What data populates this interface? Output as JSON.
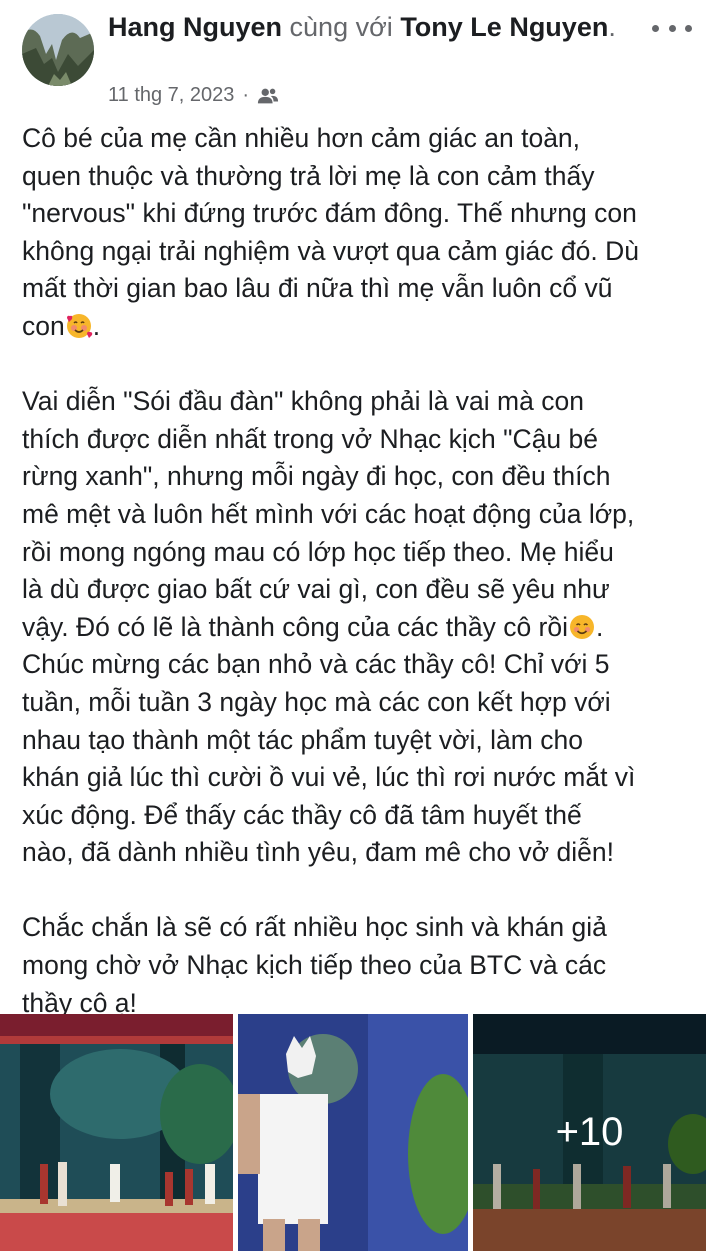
{
  "post": {
    "author": "Hang Nguyen",
    "with_text": "cùng với",
    "tagged": "Tony Le Nguyen",
    "tagged_suffix": ".",
    "date": "11 thg 7, 2023",
    "separator": "·",
    "audience_icon": "friends-icon",
    "more_icon": "more-options-icon",
    "paragraphs": {
      "p1": "Cô bé của mẹ cần nhiều hơn cảm giác an toàn,\nquen thuộc và thường trả lời mẹ là con cảm thấy\n\"nervous\" khi đứng trước đám đông. Thế nhưng con\nkhông ngại trải nghiệm và vượt qua cảm giác đó. Dù\nmất thời gian bao lâu đi nữa thì mẹ vẫn luôn cổ vũ\ncon",
      "p1_tail": ".",
      "p2": "Vai diễn \"Sói đầu đàn\" không phải là vai mà con\nthích được diễn nhất trong vở Nhạc kịch \"Cậu bé\nrừng xanh\", nhưng mỗi ngày đi học, con đều thích\nmê mệt và luôn hết mình với các hoạt động của lớp,\nrồi mong ngóng mau có lớp học tiếp theo. Mẹ hiểu\nlà dù được giao bất cứ vai gì, con đều sẽ yêu như\nvậy. Đó có lẽ là thành công của các thầy cô rồi",
      "p2_tail": ".\nChúc mừng các bạn nhỏ và các thầy cô! Chỉ  với 5\ntuần, mỗi tuần 3 ngày học mà các con kết hợp với\nnhau tạo thành một tác phẩm tuyệt vời, làm cho\nkhán giả lúc thì cười ồ vui vẻ, lúc thì rơi nước mắt vì\nxúc động. Để thấy các thầy cô đã tâm huyết thế\nnào, đã dành nhiều tình yêu, đam mê cho vở diễn!",
      "p3": "Chắc chắn là sẽ có rất nhiều học sinh và khán giả\nmong chờ vở Nhạc kịch tiếp theo của BTC và các\nthầy cô ạ!"
    },
    "emojis": [
      "smiling-face-with-hearts-icon",
      "smiling-face-icon"
    ],
    "photos": {
      "more_count": "+10"
    }
  },
  "colors": {
    "text": "#1c1e21",
    "secondary": "#65676b",
    "background": "#ffffff"
  }
}
